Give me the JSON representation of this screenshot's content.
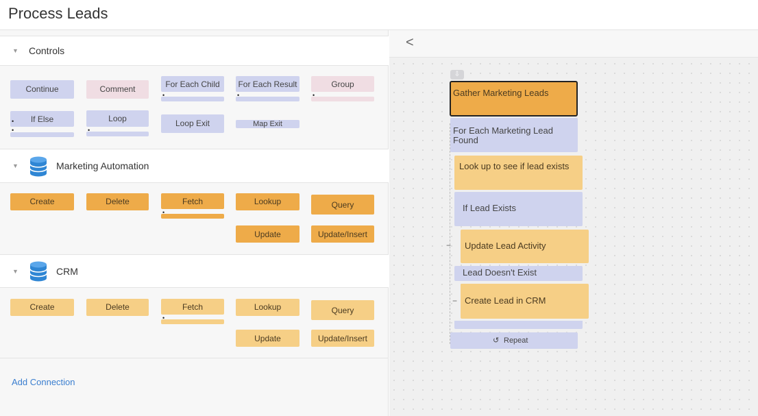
{
  "header": {
    "title": "Process Leads"
  },
  "sections": {
    "controls": {
      "label": "Controls",
      "blocks": {
        "continue": "Continue",
        "comment": "Comment",
        "for_each_child": "For Each Child",
        "for_each_result": "For Each Result",
        "group": "Group",
        "if_else": "If Else",
        "loop": "Loop",
        "loop_exit": "Loop Exit",
        "map_exit": "Map Exit"
      }
    },
    "marketing": {
      "label": "Marketing Automation",
      "blocks": {
        "create": "Create",
        "delete": "Delete",
        "fetch": "Fetch",
        "lookup": "Lookup",
        "query": "Query",
        "update": "Update",
        "upsert": "Update/Insert"
      }
    },
    "crm": {
      "label": "CRM",
      "blocks": {
        "create": "Create",
        "delete": "Delete",
        "fetch": "Fetch",
        "lookup": "Lookup",
        "query": "Query",
        "update": "Update",
        "upsert": "Update/Insert"
      }
    },
    "add_connection": "Add Connection"
  },
  "canvas": {
    "collapse_icon": "chevron-left-icon",
    "flow": {
      "gather": "Gather Marketing Leads",
      "for_each": "For Each Marketing Lead Found",
      "lookup": "Look up to see if lead exists",
      "if_exists": "If Lead Exists",
      "update_activity": "Update Lead Activity",
      "doesnt_exist": "Lead Doesn't Exist",
      "create_in_crm": "Create Lead in CRM",
      "repeat": "Repeat"
    }
  },
  "colors": {
    "orange": "#eeab49",
    "light_orange": "#f6cf86",
    "lavender": "#cfd3ee",
    "pink": "#f0dde3",
    "link": "#3a7ecf"
  }
}
